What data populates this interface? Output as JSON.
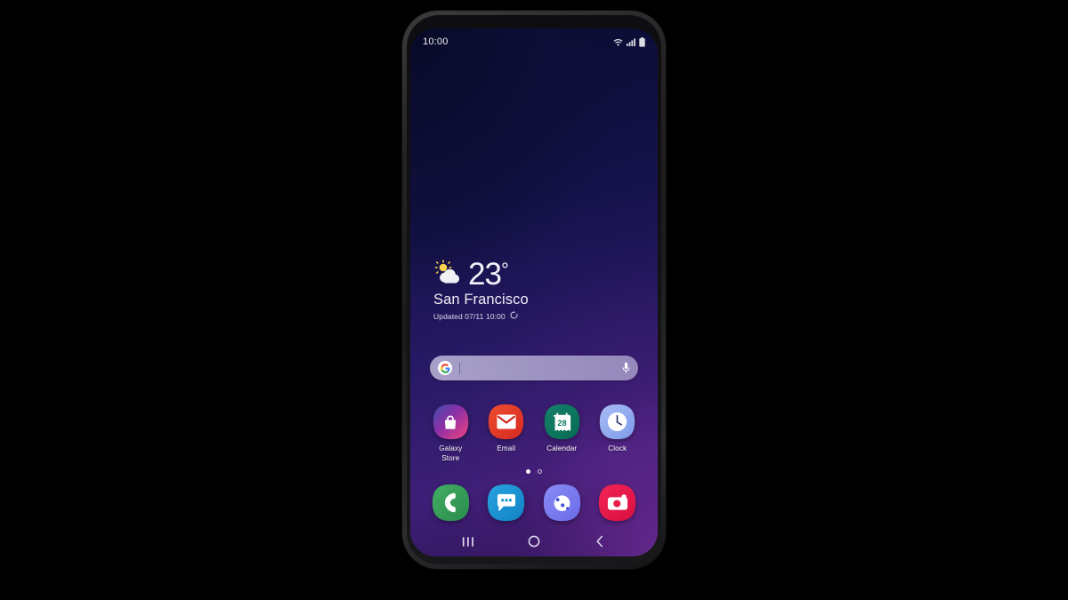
{
  "device": {
    "name": "samsung-galaxy-phone",
    "frame_color": "#232325",
    "wallpaper_colors": [
      "#0a0c30",
      "#14124a",
      "#2a1a68",
      "#3e1f78"
    ]
  },
  "status_bar": {
    "time": "10:00",
    "icons": [
      "wifi-icon",
      "cellular-signal-icon",
      "battery-icon"
    ]
  },
  "weather_widget": {
    "icon": "sun-behind-cloud-icon",
    "temperature": "23",
    "degree_symbol": "°",
    "city": "San Francisco",
    "updated_text": "Updated 07/11 10:00",
    "refresh_icon": "refresh-icon"
  },
  "search_bar": {
    "logo": "google-g-logo",
    "placeholder": "",
    "value": "",
    "mic_icon": "microphone-icon"
  },
  "app_grid": {
    "apps": [
      {
        "label": "Galaxy\nStore",
        "label_line1": "Galaxy",
        "label_line2": "Store",
        "icon": "galaxy-store-icon",
        "color": "#d62a7e"
      },
      {
        "label": "Email",
        "label_line1": "Email",
        "label_line2": "",
        "icon": "email-icon",
        "color": "#e03a28"
      },
      {
        "label": "Calendar",
        "label_line1": "Calendar",
        "label_line2": "",
        "icon": "calendar-icon",
        "color": "#0d7a5f",
        "badge_number": "28"
      },
      {
        "label": "Clock",
        "label_line1": "Clock",
        "label_line2": "",
        "icon": "clock-icon",
        "color": "#9bb2f0"
      }
    ]
  },
  "page_indicator": {
    "total": 2,
    "active_index": 0
  },
  "dock": {
    "apps": [
      {
        "label": "Phone",
        "icon": "phone-icon",
        "color": "#35a05a"
      },
      {
        "label": "Messages",
        "icon": "messages-icon",
        "color": "#1a94d4"
      },
      {
        "label": "Internet",
        "icon": "samsung-internet-icon",
        "color": "#7b7ef0"
      },
      {
        "label": "Camera",
        "icon": "camera-icon",
        "color": "#e81c4a"
      }
    ]
  },
  "nav_bar": {
    "buttons": [
      {
        "label": "Recents",
        "icon": "recents-icon"
      },
      {
        "label": "Home",
        "icon": "home-circle-icon"
      },
      {
        "label": "Back",
        "icon": "back-chevron-icon"
      }
    ]
  }
}
